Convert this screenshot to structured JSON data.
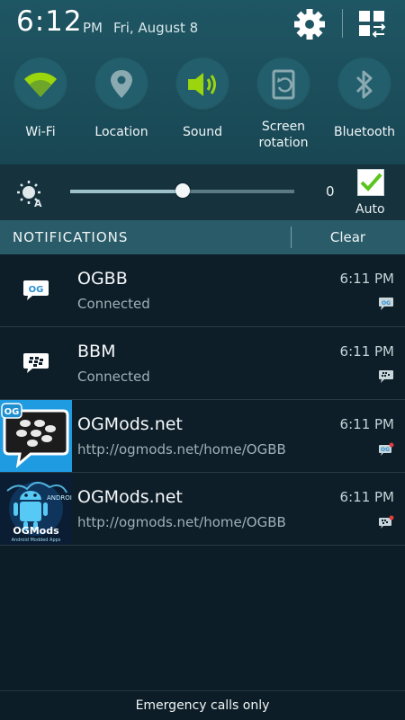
{
  "status": {
    "time": "6:12",
    "ampm": "PM",
    "date": "Fri, August 8"
  },
  "toggles": [
    {
      "label": "Wi-Fi",
      "icon": "wifi-icon",
      "active": true
    },
    {
      "label": "Location",
      "icon": "location-icon",
      "active": false
    },
    {
      "label": "Sound",
      "icon": "sound-icon",
      "active": true
    },
    {
      "label": "Screen\nrotation",
      "icon": "screen-rotation-icon",
      "active": false
    },
    {
      "label": "Bluetooth",
      "icon": "bluetooth-icon",
      "active": false
    }
  ],
  "brightness": {
    "value": "0",
    "level": 0.5,
    "auto_label": "Auto",
    "auto_checked": true
  },
  "notifications_header": {
    "title": "NOTIFICATIONS",
    "clear_label": "Clear"
  },
  "notifications": [
    {
      "title": "OGBB",
      "subtitle": "Connected",
      "time": "6:11 PM",
      "icon": "ogbb-icon"
    },
    {
      "title": "BBM",
      "subtitle": "Connected",
      "time": "6:11 PM",
      "icon": "bbm-icon"
    },
    {
      "title": "OGMods.net",
      "subtitle": "http://ogmods.net/home/OGBB",
      "time": "6:11 PM",
      "icon": "bbm-app-icon"
    },
    {
      "title": "OGMods.net",
      "subtitle": "http://ogmods.net/home/OGBB",
      "time": "6:11 PM",
      "icon": "ogmods-android-icon"
    }
  ],
  "footer": {
    "text": "Emergency calls only"
  },
  "colors": {
    "accent_green": "#9bd50e",
    "header_bg": "#1f5663",
    "list_bg": "#0e1e29"
  }
}
